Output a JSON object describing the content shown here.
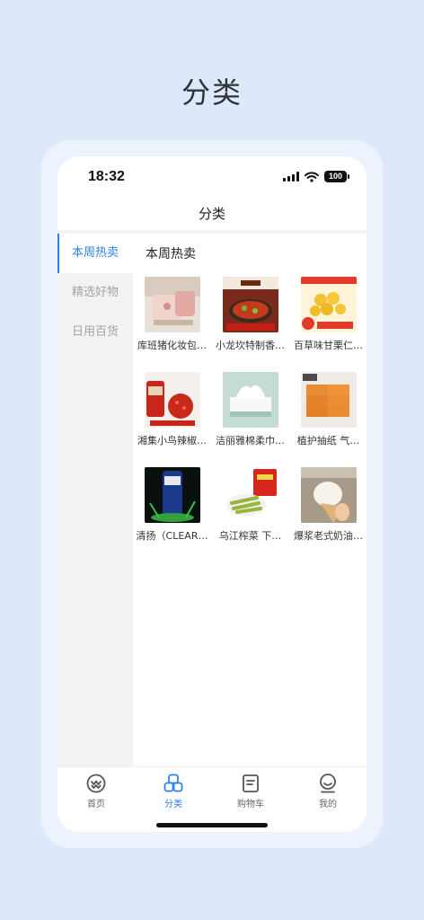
{
  "page_heading": "分类",
  "status_bar": {
    "time": "18:32",
    "battery": "100"
  },
  "nav": {
    "title": "分类"
  },
  "sidebar": {
    "items": [
      {
        "label": "本周热卖",
        "active": true
      },
      {
        "label": "精选好物",
        "active": false
      },
      {
        "label": "日用百货",
        "active": false
      }
    ]
  },
  "content": {
    "section_title": "本周热卖",
    "products": [
      {
        "name": "库班猪化妆包…",
        "image": "pink-cosmetic-bag"
      },
      {
        "name": "小龙坎特制香…",
        "image": "spicy-sauce-bowl"
      },
      {
        "name": "百草味甘栗仁…",
        "image": "chestnut-snack"
      },
      {
        "name": "湘集小鸟辣椒…",
        "image": "chili-sauce-jar"
      },
      {
        "name": "洁丽雅棉柔巾…",
        "image": "cotton-tissue-box"
      },
      {
        "name": "植护抽纸 气…",
        "image": "tissue-boxes-stack"
      },
      {
        "name": "清扬（CLEAR…",
        "image": "shampoo-bottle"
      },
      {
        "name": "乌江榨菜 下…",
        "image": "pickled-mustard"
      },
      {
        "name": "爆浆老式奶油…",
        "image": "cream-bread"
      }
    ]
  },
  "tabbar": {
    "tabs": [
      {
        "label": "首页",
        "icon": "home-icon",
        "active": false
      },
      {
        "label": "分类",
        "icon": "category-icon",
        "active": true
      },
      {
        "label": "购物车",
        "icon": "cart-icon",
        "active": false
      },
      {
        "label": "我的",
        "icon": "profile-icon",
        "active": false
      }
    ]
  },
  "colors": {
    "accent": "#2f80ed",
    "background": "#dde9fb",
    "sidebar": "#f3f3f3"
  }
}
